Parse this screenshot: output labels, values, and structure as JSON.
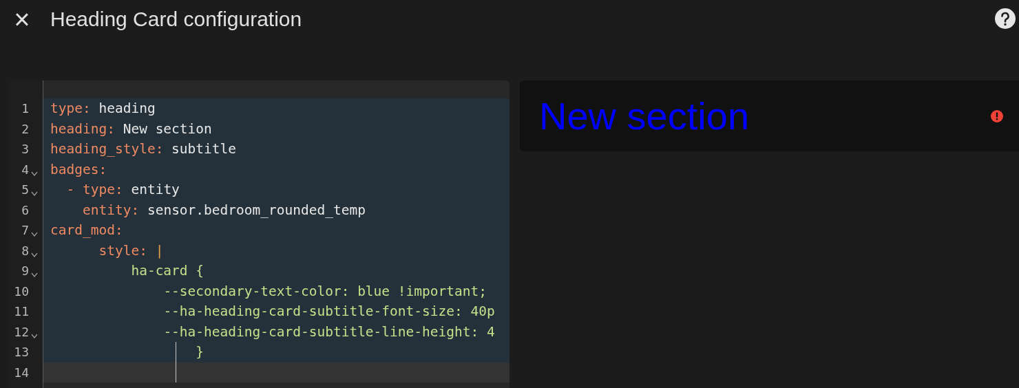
{
  "header": {
    "close_icon": "×",
    "title": "Heading Card configuration"
  },
  "editor": {
    "lines": [
      {
        "number": "1",
        "fold": false,
        "selected": true,
        "segments": [
          {
            "kind": "key",
            "text": "type"
          },
          {
            "kind": "punct",
            "text": ": "
          },
          {
            "kind": "value",
            "text": "heading"
          }
        ]
      },
      {
        "number": "2",
        "fold": false,
        "selected": true,
        "segments": [
          {
            "kind": "key",
            "text": "heading"
          },
          {
            "kind": "punct",
            "text": ": "
          },
          {
            "kind": "value",
            "text": "New section"
          }
        ]
      },
      {
        "number": "3",
        "fold": false,
        "selected": true,
        "segments": [
          {
            "kind": "key",
            "text": "heading_style"
          },
          {
            "kind": "punct",
            "text": ": "
          },
          {
            "kind": "value",
            "text": "subtitle"
          }
        ]
      },
      {
        "number": "4",
        "fold": true,
        "selected": true,
        "segments": [
          {
            "kind": "key",
            "text": "badges"
          },
          {
            "kind": "punct",
            "text": ":"
          }
        ]
      },
      {
        "number": "5",
        "fold": true,
        "selected": true,
        "segments": [
          {
            "kind": "key",
            "text": "  - type"
          },
          {
            "kind": "punct",
            "text": ": "
          },
          {
            "kind": "value",
            "text": "entity"
          }
        ]
      },
      {
        "number": "6",
        "fold": false,
        "selected": true,
        "segments": [
          {
            "kind": "key",
            "text": "    entity"
          },
          {
            "kind": "punct",
            "text": ": "
          },
          {
            "kind": "value",
            "text": "sensor.bedroom_rounded_temp"
          }
        ]
      },
      {
        "number": "7",
        "fold": true,
        "selected": true,
        "segments": [
          {
            "kind": "key",
            "text": "card_mod"
          },
          {
            "kind": "punct",
            "text": ":"
          }
        ]
      },
      {
        "number": "8",
        "fold": true,
        "selected": true,
        "segments": [
          {
            "kind": "key",
            "text": "      style"
          },
          {
            "kind": "punct",
            "text": ": "
          },
          {
            "kind": "pipe",
            "text": "|"
          }
        ]
      },
      {
        "number": "9",
        "fold": true,
        "selected": true,
        "segments": [
          {
            "kind": "css",
            "text": "          ha-card {"
          }
        ]
      },
      {
        "number": "10",
        "fold": false,
        "selected": true,
        "segments": [
          {
            "kind": "css",
            "text": "              --secondary-text-color: blue !important;"
          }
        ]
      },
      {
        "number": "11",
        "fold": false,
        "selected": true,
        "segments": [
          {
            "kind": "css",
            "text": "              --ha-heading-card-subtitle-font-size: 40p"
          }
        ]
      },
      {
        "number": "12",
        "fold": true,
        "selected": true,
        "segments": [
          {
            "kind": "css",
            "text": "              --ha-heading-card-subtitle-line-height: 4"
          }
        ]
      },
      {
        "number": "13",
        "fold": false,
        "selected": true,
        "segments": [
          {
            "kind": "css",
            "text": "                  }"
          }
        ]
      },
      {
        "number": "14",
        "fold": false,
        "selected": false
      }
    ]
  },
  "preview": {
    "heading": "New section",
    "error": true
  }
}
